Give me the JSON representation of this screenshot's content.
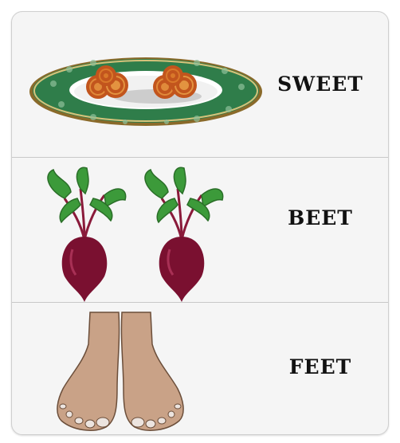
{
  "cards": [
    {
      "word": "SWEET",
      "icon": "jalebi-plate-icon"
    },
    {
      "word": "BEET",
      "icon": "beetroot-icon"
    },
    {
      "word": "FEET",
      "icon": "feet-icon"
    }
  ],
  "colors": {
    "background": "#f5f5f5",
    "plate": "#2f7d4a",
    "beet": "#7a1030",
    "leaf": "#3c9a3a",
    "skin": "#c9a287",
    "sweet": "#d9782a"
  }
}
